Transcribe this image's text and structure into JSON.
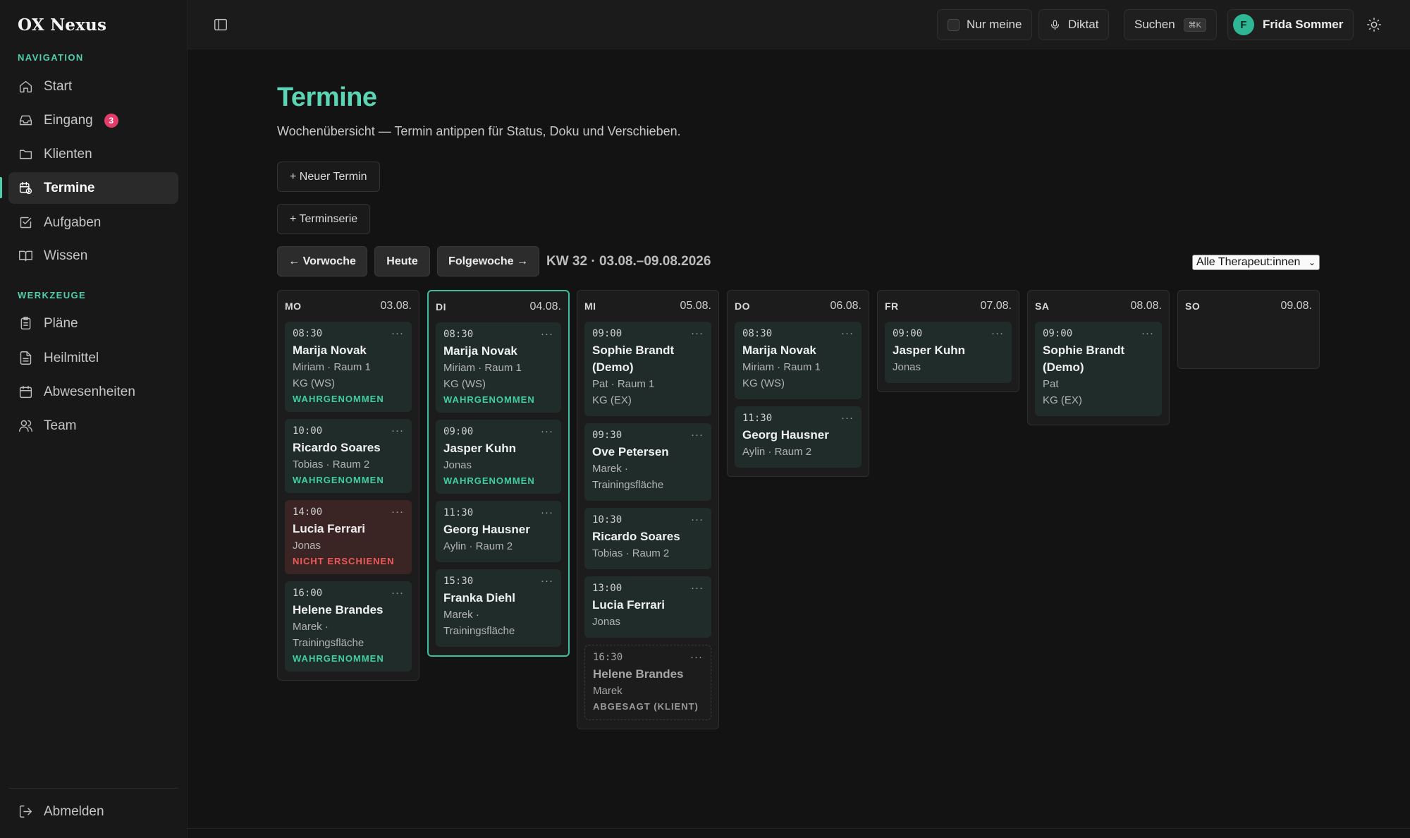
{
  "app": {
    "title": "OX Nexus"
  },
  "sidebar": {
    "nav_label": "NAVIGATION",
    "tools_label": "WERKZEUGE",
    "items": [
      {
        "label": "Start",
        "icon": "home-icon"
      },
      {
        "label": "Eingang",
        "icon": "inbox-icon",
        "badge": "3"
      },
      {
        "label": "Klienten",
        "icon": "folder-icon"
      },
      {
        "label": "Termine",
        "icon": "calendar-clock-icon",
        "active": true
      },
      {
        "label": "Aufgaben",
        "icon": "checkbox-icon"
      },
      {
        "label": "Wissen",
        "icon": "book-icon"
      }
    ],
    "tools": [
      {
        "label": "Pläne",
        "icon": "clipboard-icon"
      },
      {
        "label": "Heilmittel",
        "icon": "document-icon"
      },
      {
        "label": "Abwesenheiten",
        "icon": "calendar-icon"
      },
      {
        "label": "Team",
        "icon": "users-icon"
      }
    ],
    "logout": "Abmelden"
  },
  "topbar": {
    "only_mine": "Nur meine",
    "dictate": "Diktat",
    "search": "Suchen",
    "search_shortcut": "⌘K",
    "user_initial": "F",
    "user_name": "Frida Sommer"
  },
  "main": {
    "title": "Termine",
    "subtitle": "Wochenübersicht — Termin antippen für Status, Doku und Verschieben.",
    "new_appt": "+ Neuer Termin",
    "new_series": "+ Terminserie",
    "prev_week": "← Vorwoche",
    "today": "Heute",
    "next_week": "Folgewoche →",
    "week_label": "KW 32 · 03.08.–09.08.2026",
    "therapist_filter": "Alle Therapeut:innen"
  },
  "colors": {
    "accent": "#4fcfae",
    "status_done": "#3fcf9e",
    "status_noshow": "#ee5a5a",
    "badge": "#e23d6a"
  },
  "days": [
    {
      "name": "MO",
      "date": "03.08.",
      "appointments": [
        {
          "time": "08:30",
          "client": "Marija Novak",
          "meta": [
            "Miriam · Raum 1",
            "KG (WS)"
          ],
          "status": "WAHRGENOMMEN",
          "kind": "done"
        },
        {
          "time": "10:00",
          "client": "Ricardo Soares",
          "meta": [
            "Tobias · Raum 2"
          ],
          "status": "WAHRGENOMMEN",
          "kind": "done"
        },
        {
          "time": "14:00",
          "client": "Lucia Ferrari",
          "meta": [
            "Jonas"
          ],
          "status": "NICHT ERSCHIENEN",
          "kind": "noshow"
        },
        {
          "time": "16:00",
          "client": "Helene Brandes",
          "meta": [
            "Marek ·",
            "Trainingsfläche"
          ],
          "status": "WAHRGENOMMEN",
          "kind": "done"
        }
      ]
    },
    {
      "name": "DI",
      "date": "04.08.",
      "today": true,
      "appointments": [
        {
          "time": "08:30",
          "client": "Marija Novak",
          "meta": [
            "Miriam · Raum 1",
            "KG (WS)"
          ],
          "status": "WAHRGENOMMEN",
          "kind": "done"
        },
        {
          "time": "09:00",
          "client": "Jasper Kuhn",
          "meta": [
            "Jonas"
          ],
          "status": "WAHRGENOMMEN",
          "kind": "done"
        },
        {
          "time": "11:30",
          "client": "Georg Hausner",
          "meta": [
            "Aylin · Raum 2"
          ],
          "status": "",
          "kind": "open"
        },
        {
          "time": "15:30",
          "client": "Franka Diehl",
          "meta": [
            "Marek ·",
            "Trainingsfläche"
          ],
          "status": "",
          "kind": "open"
        }
      ]
    },
    {
      "name": "MI",
      "date": "05.08.",
      "appointments": [
        {
          "time": "09:00",
          "client": "Sophie Brandt (Demo)",
          "meta": [
            "Pat · Raum 1",
            "KG (EX)"
          ],
          "status": "",
          "kind": "open"
        },
        {
          "time": "09:30",
          "client": "Ove Petersen",
          "meta": [
            "Marek ·",
            "Trainingsfläche"
          ],
          "status": "",
          "kind": "open"
        },
        {
          "time": "10:30",
          "client": "Ricardo Soares",
          "meta": [
            "Tobias · Raum 2"
          ],
          "status": "",
          "kind": "open"
        },
        {
          "time": "13:00",
          "client": "Lucia Ferrari",
          "meta": [
            "Jonas"
          ],
          "status": "",
          "kind": "open"
        },
        {
          "time": "16:30",
          "client": "Helene Brandes",
          "meta": [
            "Marek"
          ],
          "status": "ABGESAGT (KLIENT)",
          "kind": "cancelled"
        }
      ]
    },
    {
      "name": "DO",
      "date": "06.08.",
      "appointments": [
        {
          "time": "08:30",
          "client": "Marija Novak",
          "meta": [
            "Miriam · Raum 1",
            "KG (WS)"
          ],
          "status": "",
          "kind": "open"
        },
        {
          "time": "11:30",
          "client": "Georg Hausner",
          "meta": [
            "Aylin · Raum 2"
          ],
          "status": "",
          "kind": "open"
        }
      ]
    },
    {
      "name": "FR",
      "date": "07.08.",
      "appointments": [
        {
          "time": "09:00",
          "client": "Jasper Kuhn",
          "meta": [
            "Jonas"
          ],
          "status": "",
          "kind": "open"
        }
      ]
    },
    {
      "name": "SA",
      "date": "08.08.",
      "appointments": [
        {
          "time": "09:00",
          "client": "Sophie Brandt (Demo)",
          "meta": [
            "Pat",
            "KG (EX)"
          ],
          "status": "",
          "kind": "open"
        }
      ]
    },
    {
      "name": "SO",
      "date": "09.08.",
      "appointments": []
    }
  ]
}
